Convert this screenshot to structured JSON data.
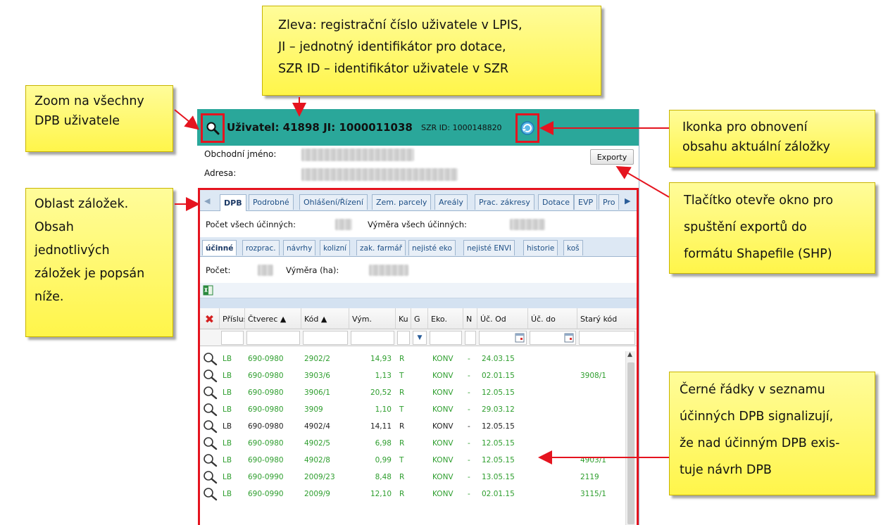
{
  "callouts": {
    "top": "Zleva: registrační číslo uživatele v LPIS,\nJI – jednotný identifikátor pro dotace,\nSZR ID – identifikátor uživatele v SZR",
    "zoom": "Zoom na všechny\nDPB uživatele",
    "refresh": "Ikonka pro obnovení\nobsahu aktuální záložky",
    "tabs": "Oblast záložek.\nObsah\njednotlivých\nzáložek je popsán\nníže.",
    "export": "Tlačítko otevře okno pro\nspuštění exportů do\nformátu Shapefile (SHP)",
    "black_rows": "Černé řádky v seznamu\núčinných DPB signalizují,\nže nad účinným DPB exis-\ntuje návrh DPB"
  },
  "header": {
    "title": "Uživatel: 41898 JI: 1000011038",
    "szr": "SZR ID: 1000148820",
    "bg_color": "#2aa79a"
  },
  "info": {
    "business_name_label": "Obchodní jméno:",
    "address_label": "Adresa:",
    "export_button": "Exporty"
  },
  "tabs": [
    {
      "label": "DPB",
      "active": true
    },
    {
      "label": "Podrobné"
    },
    {
      "label": "Ohlášení/Řízení"
    },
    {
      "label": "Zem. parcely"
    },
    {
      "label": "Areály"
    },
    {
      "label": "Prac. zákresy"
    },
    {
      "label": "Dotace"
    },
    {
      "label": "EVP"
    },
    {
      "label": "Pro"
    }
  ],
  "stats": {
    "total_count_label": "Počet všech účinných:",
    "total_area_label": "Výměra všech účinných:",
    "count_label": "Počet:",
    "area_label": "Výměra (ha):"
  },
  "subtabs": [
    {
      "label": "účinné",
      "active": true
    },
    {
      "label": "rozprac."
    },
    {
      "label": "návrhy"
    },
    {
      "label": "kolizní"
    },
    {
      "label": "zak. farmář"
    },
    {
      "label": "nejisté eko"
    },
    {
      "label": "nejisté ENVI"
    },
    {
      "label": "historie"
    },
    {
      "label": "koš"
    }
  ],
  "columns": [
    "Přísluš",
    "Čtverec ▲",
    "Kód ▲",
    "Vým.",
    "Ku",
    "G",
    "Eko.",
    "N",
    "Úč. Od",
    "Úč. do",
    "Starý kód"
  ],
  "rows": [
    {
      "pris": "LB",
      "ctverec": "690-0980",
      "kod": "2902/2",
      "vym": "14,93",
      "ku": "R",
      "eko": "KONV",
      "n": "-",
      "od": "24.03.15",
      "stary": "",
      "color": "green"
    },
    {
      "pris": "LB",
      "ctverec": "690-0980",
      "kod": "3903/6",
      "vym": "1,13",
      "ku": "T",
      "eko": "KONV",
      "n": "-",
      "od": "02.01.15",
      "stary": "3908/1",
      "color": "green"
    },
    {
      "pris": "LB",
      "ctverec": "690-0980",
      "kod": "3906/1",
      "vym": "20,52",
      "ku": "R",
      "eko": "KONV",
      "n": "-",
      "od": "12.05.15",
      "stary": "",
      "color": "green"
    },
    {
      "pris": "LB",
      "ctverec": "690-0980",
      "kod": "3909",
      "vym": "1,10",
      "ku": "T",
      "eko": "KONV",
      "n": "-",
      "od": "29.03.12",
      "stary": "",
      "color": "green"
    },
    {
      "pris": "LB",
      "ctverec": "690-0980",
      "kod": "4902/4",
      "vym": "14,11",
      "ku": "R",
      "eko": "KONV",
      "n": "-",
      "od": "12.05.15",
      "stary": "",
      "color": "black"
    },
    {
      "pris": "LB",
      "ctverec": "690-0980",
      "kod": "4902/5",
      "vym": "6,98",
      "ku": "R",
      "eko": "KONV",
      "n": "-",
      "od": "12.05.15",
      "stary": "",
      "color": "green"
    },
    {
      "pris": "LB",
      "ctverec": "690-0980",
      "kod": "4902/8",
      "vym": "0,99",
      "ku": "T",
      "eko": "KONV",
      "n": "-",
      "od": "12.05.15",
      "stary": "4903/1",
      "color": "green"
    },
    {
      "pris": "LB",
      "ctverec": "690-0990",
      "kod": "2009/23",
      "vym": "8,48",
      "ku": "R",
      "eko": "KONV",
      "n": "-",
      "od": "13.05.15",
      "stary": "2119",
      "color": "green"
    },
    {
      "pris": "LB",
      "ctverec": "690-0990",
      "kod": "2009/9",
      "vym": "12,10",
      "ku": "R",
      "eko": "KONV",
      "n": "-",
      "od": "02.01.15",
      "stary": "3115/1",
      "color": "green"
    }
  ],
  "icons": {
    "zoom": "magnifier-icon",
    "refresh": "refresh-icon",
    "excel": "excel-export-icon",
    "delete_filter": "red-x-icon"
  }
}
